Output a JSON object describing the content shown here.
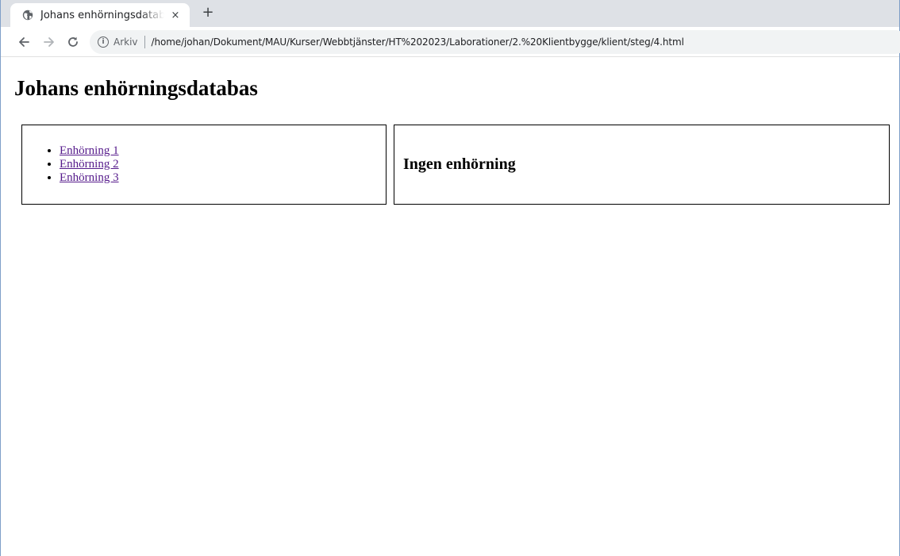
{
  "browser": {
    "tab": {
      "title": "Johans enhörningsdatabas",
      "favicon": "globe-icon",
      "close_glyph": "×"
    },
    "new_tab_glyph": "+",
    "toolbar": {
      "back_icon": "arrow-left-icon",
      "forward_icon": "arrow-right-icon",
      "reload_icon": "reload-icon",
      "info_glyph": "i",
      "scheme_label": "Arkiv",
      "url": "/home/johan/Dokument/MAU/Kurser/Webbtjänster/HT%202023/Laborationer/2.%20Klientbygge/klient/steg/4.html"
    }
  },
  "page": {
    "title": "Johans enhörningsdatabas",
    "unicorns": [
      {
        "label": "Enhörning 1"
      },
      {
        "label": "Enhörning 2"
      },
      {
        "label": "Enhörning 3"
      }
    ],
    "detail": {
      "heading": "Ingen enhörning"
    }
  },
  "colors": {
    "tab_strip": "#dee1e6",
    "omnibox": "#f1f3f4",
    "visited_link": "#551a8b",
    "frame_border": "#7f9fc8"
  }
}
